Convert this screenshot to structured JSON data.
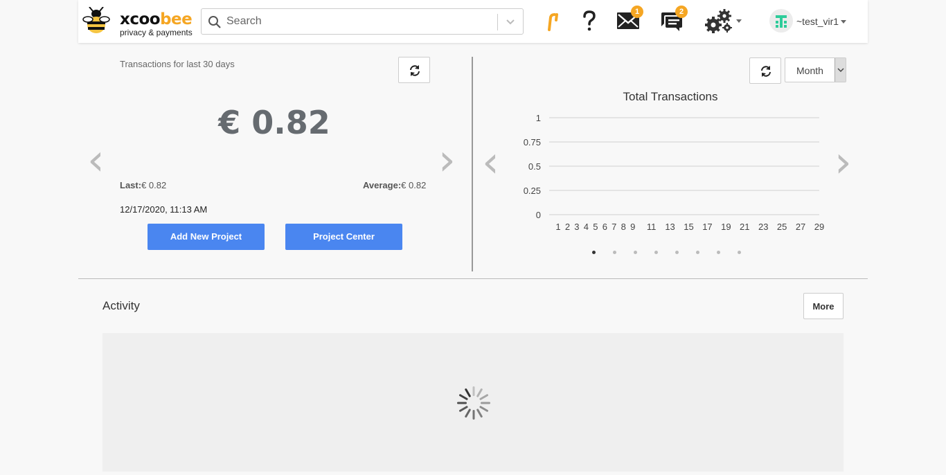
{
  "header": {
    "logo": {
      "word_a": "xcoo",
      "word_b": "bee",
      "tagline": "privacy & payments"
    },
    "search": {
      "placeholder": "Search",
      "value": ""
    },
    "icons": [
      "brand-f-icon",
      "help-icon",
      "mail-icon",
      "chat-icon",
      "settings-icon"
    ],
    "mail_badge": "1",
    "chat_badge": "2",
    "user": {
      "name": "~test_vir1"
    }
  },
  "summary": {
    "label": "Transactions for last 30 days",
    "amount": "€ 0.82",
    "last_label": "Last:",
    "last_value": "€ 0.82",
    "average_label": "Average:",
    "average_value": "€ 0.82",
    "date": "12/17/2020, 11:13 AM",
    "add_project_label": "Add New Project",
    "project_center_label": "Project Center"
  },
  "chart_panel": {
    "period_select": "Month"
  },
  "chart_data": {
    "type": "line",
    "title": "Total Transactions",
    "xlabel": "",
    "ylabel": "",
    "x": [
      1,
      2,
      3,
      4,
      5,
      6,
      7,
      8,
      9,
      10,
      11,
      12,
      13,
      14,
      15,
      16,
      17,
      18,
      19,
      20,
      21,
      22,
      23,
      24,
      25,
      26,
      27,
      28,
      29
    ],
    "x_tick_labels": [
      "1",
      "2",
      "3",
      "4",
      "5",
      "6",
      "7",
      "8",
      "9",
      "11",
      "13",
      "15",
      "17",
      "19",
      "21",
      "23",
      "25",
      "27",
      "29"
    ],
    "y_tick_labels": [
      "1",
      "0.75",
      "0.5",
      "0.25",
      "0"
    ],
    "ylim": [
      0,
      1
    ],
    "grid": true,
    "series": [
      {
        "values": []
      }
    ]
  },
  "carousel": {
    "pages": 8,
    "active": 1
  },
  "activity": {
    "title": "Activity",
    "more_label": "More"
  },
  "colors": {
    "accent": "#f5a623",
    "primary_button": "#4a86f0",
    "avatar": "#2ecc9a"
  }
}
